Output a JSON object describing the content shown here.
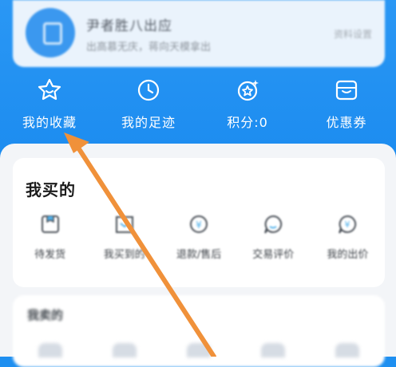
{
  "profile": {
    "name": "尹者胜八出应",
    "subtitle": "出高慕无庆，蒋向天模拿出",
    "right_text": "资料设置"
  },
  "quick_actions": [
    {
      "label": "我的收藏",
      "icon": "star-face-icon"
    },
    {
      "label": "我的足迹",
      "icon": "clock-icon"
    },
    {
      "label": "积分:0",
      "icon": "sparkle-badge-icon"
    },
    {
      "label": "优惠券",
      "icon": "wallet-box-icon"
    }
  ],
  "orders": {
    "title": "我买的",
    "items": [
      {
        "label": "待发货",
        "icon": "box-icon"
      },
      {
        "label": "我买到的",
        "icon": "basket-icon"
      },
      {
        "label": "退款/售后",
        "icon": "refund-icon"
      },
      {
        "label": "交易评价",
        "icon": "chat-bubble-icon"
      },
      {
        "label": "我的出价",
        "icon": "coin-bubble-icon"
      }
    ]
  },
  "section2": {
    "title": "我卖的"
  },
  "colors": {
    "accent": "#1c8cf0",
    "arrow": "#f0913a"
  }
}
